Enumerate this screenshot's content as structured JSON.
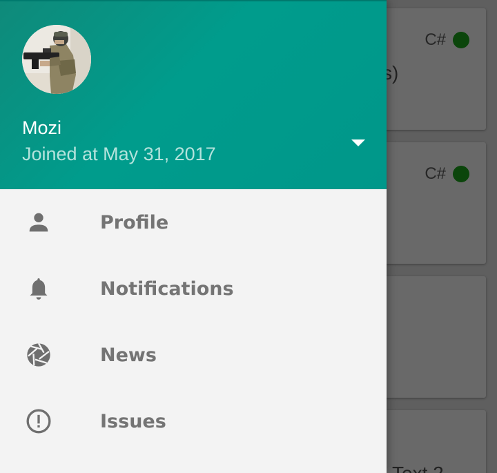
{
  "drawer": {
    "user": {
      "name": "Mozi",
      "joined": "Joined at May 31, 2017"
    },
    "menu": [
      {
        "label": "Profile",
        "icon": "person-icon"
      },
      {
        "label": "Notifications",
        "icon": "bell-icon"
      },
      {
        "label": "News",
        "icon": "camera-shutter-icon"
      },
      {
        "label": "Issues",
        "icon": "alert-circle-icon"
      }
    ]
  },
  "background": {
    "cards": [
      {
        "language": "C#",
        "fragment": "s)"
      },
      {
        "language": "C#",
        "fragment": ""
      },
      {
        "language": "",
        "fragment": ""
      },
      {
        "language": "",
        "fragment": "Text 2"
      }
    ]
  },
  "colors": {
    "header": "#009688",
    "drawer_bg": "#f3f3f3",
    "menu_text": "#747474",
    "lang_dot": "#0d4d0d"
  }
}
